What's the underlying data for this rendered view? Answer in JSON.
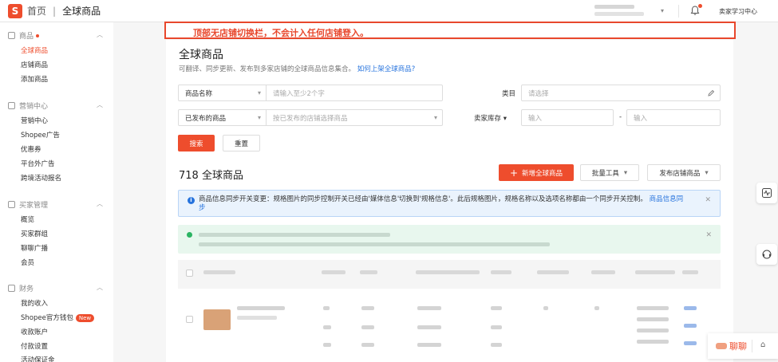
{
  "topbar": {
    "home": "首页",
    "separator": "|",
    "current": "全球商品",
    "seller_center": "卖家学习中心",
    "icons": [
      "shopee-logo-icon",
      "chevron-down-icon",
      "bell-icon"
    ]
  },
  "sidebar": {
    "sections": [
      {
        "title": "商品",
        "has_dot": true,
        "items": [
          "全球商品",
          "店铺商品",
          "添加商品"
        ],
        "active": "全球商品"
      },
      {
        "title": "营销中心",
        "items": [
          "营销中心",
          "Shopee广告",
          "优惠券",
          "平台外广告",
          "跨境活动报名"
        ]
      },
      {
        "title": "买家管理",
        "items": [
          "概览",
          "买家群组",
          "聊聊广播",
          "会员"
        ]
      },
      {
        "title": "财务",
        "items": [
          "我的收入",
          "Shopee官方钱包",
          "收款账户",
          "付款设置",
          "活动保证金"
        ],
        "badge": "New"
      }
    ]
  },
  "notice": {
    "text": "顶部无店铺切换栏，不会计入任何店铺登入。",
    "color": "#e8472c"
  },
  "main": {
    "title": "全球商品",
    "subtitle": "可翻译、同步更新、发布到多家店铺的全球商品信息集合。",
    "subtitle_link": "如何上架全球商品?",
    "filters": {
      "name_select": "商品名称",
      "name_placeholder": "请输入至少2个字",
      "category_label": "类目",
      "category_placeholder": "请选择",
      "published_select": "已发布的商品",
      "published_placeholder": "按已发布的店铺选择商品",
      "stock_label": "卖家库存",
      "stock_min_placeholder": "输入",
      "stock_dash": "-",
      "stock_max_placeholder": "输入"
    },
    "search_button": "搜索",
    "reset_button": "重置",
    "count_title": "718 全球商品",
    "add_button": "新增全球商品",
    "bulk_button": "批量工具",
    "publish_button": "发布店铺商品",
    "info": {
      "text": "商品信息同步开关变更：规格图片的同步控制开关已经由'媒体信息'切换到'规格信息'。此后规格图片，规格名称以及选项名称都由一个同步开关控制。",
      "link": "商品信息同步"
    },
    "accent": "#ee4d2d"
  },
  "float": {
    "chat_label": "聊聊"
  }
}
